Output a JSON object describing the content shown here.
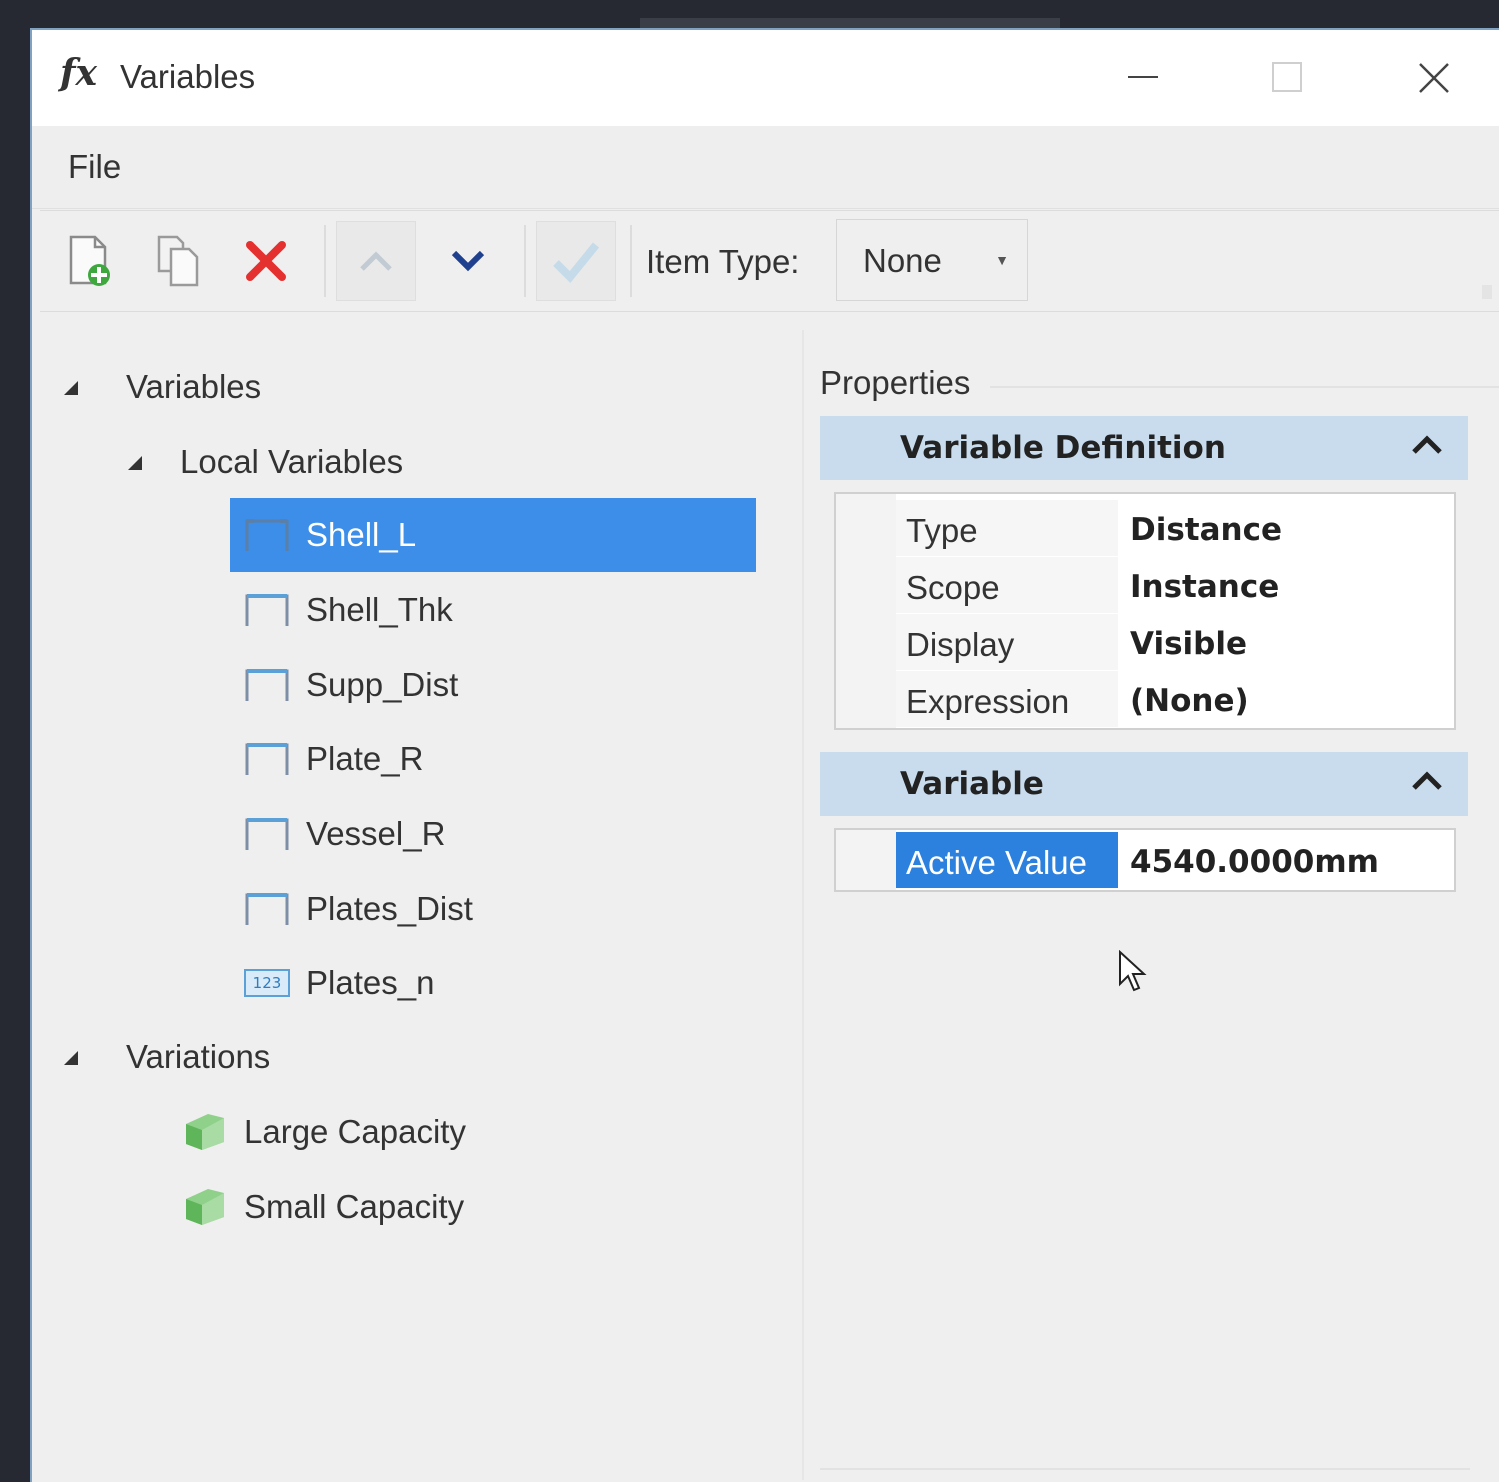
{
  "window": {
    "icon_symbol": "fx",
    "title": "Variables"
  },
  "menu": {
    "file_label": "File"
  },
  "toolbar": {
    "buttons": [
      {
        "icon": "new-variable-icon"
      },
      {
        "icon": "copy-icon"
      },
      {
        "icon": "delete-icon"
      },
      {
        "icon": "move-up-icon"
      },
      {
        "icon": "move-down-icon"
      },
      {
        "icon": "apply-check-icon"
      }
    ],
    "item_type_label": "Item Type:",
    "item_type_value": "None"
  },
  "tree": {
    "root_label": "Variables",
    "local_label": "Local Variables",
    "variables": [
      {
        "name": "Shell_L",
        "icon": "distance-icon",
        "selected": true
      },
      {
        "name": "Shell_Thk",
        "icon": "distance-icon"
      },
      {
        "name": "Supp_Dist",
        "icon": "distance-icon"
      },
      {
        "name": "Plate_R",
        "icon": "distance-icon"
      },
      {
        "name": "Vessel_R",
        "icon": "distance-icon"
      },
      {
        "name": "Plates_Dist",
        "icon": "distance-icon"
      },
      {
        "name": "Plates_n",
        "icon": "number-icon",
        "icon_text": "123"
      }
    ],
    "variations_label": "Variations",
    "variations": [
      {
        "name": "Large Capacity",
        "icon": "variation-icon"
      },
      {
        "name": "Small Capacity",
        "icon": "variation-icon"
      }
    ]
  },
  "properties": {
    "title": "Properties",
    "definition_title": "Variable Definition",
    "definition_rows": [
      {
        "key": "Type",
        "value": "Distance"
      },
      {
        "key": "Scope",
        "value": "Instance"
      },
      {
        "key": "Display",
        "value": "Visible"
      },
      {
        "key": "Expression",
        "value": "(None)"
      }
    ],
    "variable_title": "Variable",
    "active_value_key": "Active Value",
    "active_value": "4540.0000mm"
  },
  "colors": {
    "selection": "#3c8ee8",
    "section_header": "#c9dcee",
    "delete_red": "#e53030",
    "down_arrow_blue": "#1f3f8f",
    "variation_green": "#5fb55a"
  }
}
